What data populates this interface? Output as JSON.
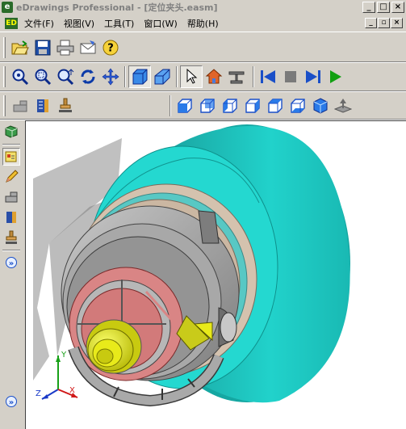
{
  "window": {
    "app_icon_glyph": "e",
    "title": "eDrawings Professional - [定位夹头.easm]",
    "caption_buttons": [
      "_",
      "□",
      "×"
    ]
  },
  "menubar": {
    "doc_icon_glyph": "ED",
    "items": [
      "文件(F)",
      "视图(V)",
      "工具(T)",
      "窗口(W)",
      "帮助(H)"
    ],
    "mdi_buttons": [
      "_",
      "▫",
      "×"
    ]
  },
  "toolbar_main": {
    "buttons": [
      "open-icon",
      "save-icon",
      "print-icon",
      "email-icon",
      "help-icon"
    ]
  },
  "toolbar_view": {
    "buttons": [
      "zoom-fit-icon",
      "zoom-area-icon",
      "zoom-in-out-icon",
      "rotate-icon",
      "pan-icon",
      "shaded-icon",
      "perspective-icon",
      "select-icon",
      "home-icon",
      "section-icon"
    ],
    "animation": [
      "first-icon",
      "stop-icon",
      "next-icon",
      "play-icon"
    ]
  },
  "toolbar_views": {
    "tools": [
      "measure-icon",
      "section-tool-icon",
      "stamp-icon"
    ],
    "orientations": [
      "front-view-icon",
      "back-view-icon",
      "left-view-icon",
      "right-view-icon",
      "top-view-icon",
      "bottom-view-icon",
      "isometric-view-icon",
      "ground-plane-icon"
    ]
  },
  "sidebar": {
    "buttons": [
      "components-icon",
      "markup-icon",
      "measure-icon",
      "cross-section-icon",
      "stamp-icon"
    ],
    "expand_glyph": "»"
  },
  "triad": {
    "x": "X",
    "y": "Y",
    "z": "Z"
  },
  "colors": {
    "teal_body": "#1fc9c2",
    "gray_part": "#9a9a9a",
    "red_face": "#d97f7f",
    "yellow_bolt": "#e8ea1a"
  }
}
